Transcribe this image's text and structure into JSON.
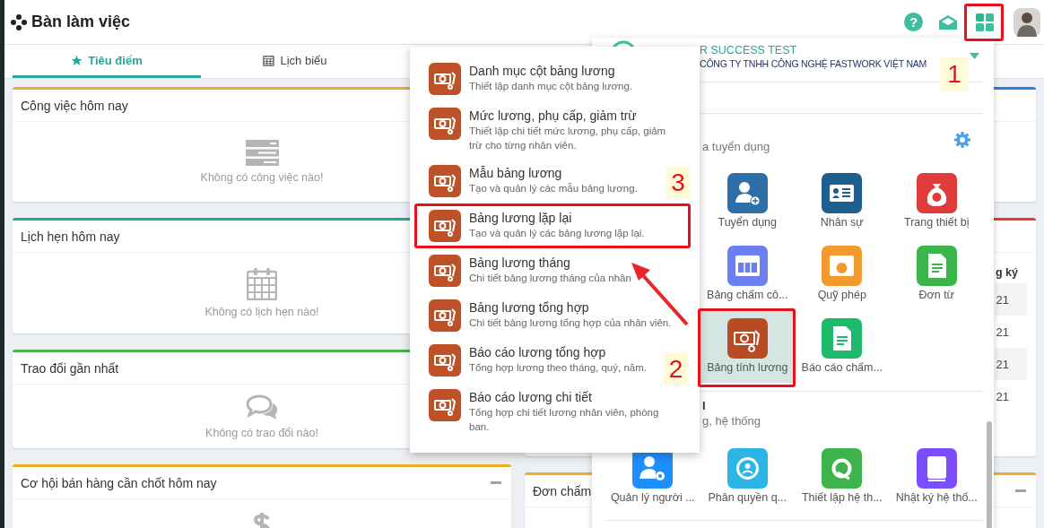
{
  "header": {
    "title": "Bàn làm việc",
    "help": "?"
  },
  "tabs": [
    {
      "label": "Tiêu điểm",
      "selected": true,
      "kind": "star"
    },
    {
      "label": "Lịch biểu",
      "selected": false,
      "kind": "calendar"
    }
  ],
  "left_cards": [
    {
      "title": "Công việc hôm nay",
      "color": "#e8ae2c",
      "kind": "tasks",
      "empty_text": "Không có công việc nào!"
    },
    {
      "title": "Lịch hẹn hôm nay",
      "color": "#26a69a",
      "kind": "calendar",
      "empty_text": "Không có lịch hẹn nào!"
    },
    {
      "title": "Trao đổi gần nhất",
      "color": "#4caf50",
      "kind": "chat",
      "empty_text": "Không có trao đổi nào!"
    },
    {
      "title": "Cơ hội bán hàng cần chốt hôm nay",
      "color": "#e8ae2c",
      "kind": "money"
    }
  ],
  "right_cards": [
    {
      "color": "#2f7de1"
    },
    {
      "color": "#e53935",
      "table": {
        "header": "g ký",
        "rows": [
          "21",
          "21",
          "21",
          "21"
        ]
      }
    },
    {
      "color": "#e8ae2c",
      "title": "Đơn chấm"
    }
  ],
  "app_panel": {
    "account": {
      "name": "R SUCCESS TEST",
      "company": "CÔNG TY TNHH CÔNG NGHỆ FASTWORK VIỆT NAM"
    },
    "sections": [
      {
        "subtitle": "a tuyển dụng",
        "apps": [
          {
            "label": "Tuyển dụng",
            "color": "#2e6fa7",
            "kind": "recruit",
            "selected": false
          },
          {
            "label": "Nhân sự",
            "color": "#1d5f8e",
            "kind": "staff",
            "selected": false
          },
          {
            "label": "Trang thiết bị",
            "color": "#e03c3c",
            "kind": "equipment",
            "selected": false
          },
          {
            "label": "Bảng chấm cô...",
            "color": "#6b7ff0",
            "kind": "timesheet",
            "selected": false
          },
          {
            "label": "Quỹ phép",
            "color": "#f29a2e",
            "kind": "leave",
            "selected": false
          },
          {
            "label": "Đơn từ",
            "color": "#3bb54a",
            "kind": "request",
            "selected": false
          },
          {
            "label": "Bảng tính lương",
            "color": "#b94a22",
            "kind": "payroll",
            "selected": true
          },
          {
            "label": "Báo cáo chấm...",
            "color": "#1dba6b",
            "kind": "report",
            "selected": false
          }
        ]
      },
      {
        "heading": "l",
        "subtitle": "g, hệ thống",
        "apps": [
          {
            "label": "Quản lý người ...",
            "color": "#1e8fff",
            "kind": "users",
            "selected": false
          },
          {
            "label": "Phân quyền q...",
            "color": "#2ab5e6",
            "kind": "permission",
            "selected": false
          },
          {
            "label": "Thiết lập hệ th...",
            "color": "#3cb44b",
            "kind": "settings",
            "selected": false
          },
          {
            "label": "Nhật ký hệ thố...",
            "color": "#7c4dff",
            "kind": "log",
            "selected": false
          }
        ]
      }
    ]
  },
  "payroll_menu": {
    "items": [
      {
        "title": "Danh mục cột bảng lương",
        "description": "Thiết lập danh mục cột bảng lương."
      },
      {
        "title": "Mức lương, phụ cấp, giảm trừ",
        "description": "Thiết lập chi tiết mức lương, phụ cấp, giảm trừ cho từng nhân viên."
      },
      {
        "title": "Mẫu bảng lương",
        "description": "Tạo và quản lý các mẫu bảng lương."
      },
      {
        "title": "Bảng lương lặp lại",
        "description": "Tạo và quản lý các bảng lương lặp lại."
      },
      {
        "title": "Bảng lương tháng",
        "description": "Chi tiết bảng lương tháng của nhân"
      },
      {
        "title": "Bảng lương tổng hợp",
        "description": "Chi tiết bảng lương tổng hợp của nhân viên."
      },
      {
        "title": "Báo cáo lương tổng hợp",
        "description": "Tổng hợp lương theo tháng, quý, năm."
      },
      {
        "title": "Báo cáo lương chi tiết",
        "description": "Tổng hợp chi tiết lương nhân viên, phòng ban."
      }
    ]
  },
  "annotations": [
    {
      "label": "1"
    },
    {
      "label": "3"
    },
    {
      "label": "2"
    }
  ]
}
